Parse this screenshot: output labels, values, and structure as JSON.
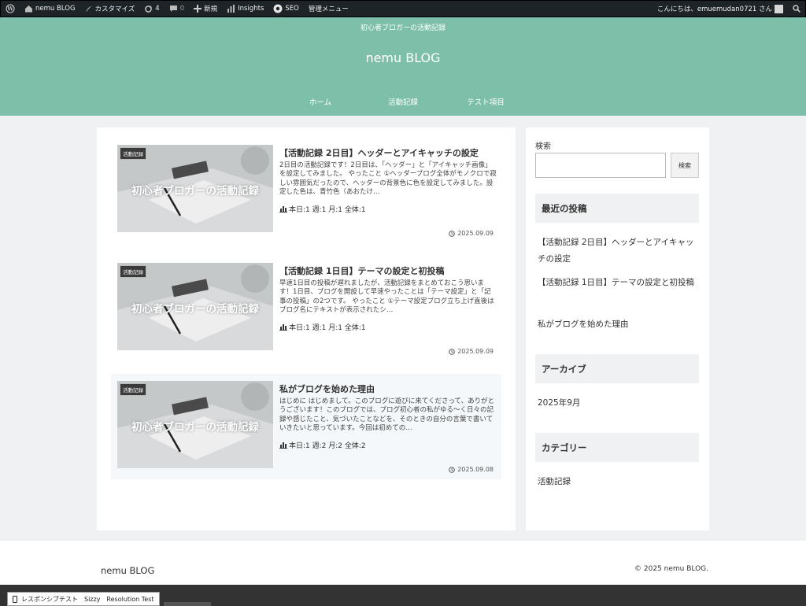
{
  "admin_bar": {
    "site_name": "nemu BLOG",
    "customize": "カスタマイズ",
    "updates_count": "4",
    "comments_count": "0",
    "new": "新規",
    "insights": "Insights",
    "seo": "SEO",
    "admin_menu": "管理メニュー",
    "greeting": "こんにちは、emuemudan0721 さん"
  },
  "header": {
    "tagline": "初心者ブロガーの活動記録",
    "site_title": "nemu BLOG",
    "nav": [
      "ホーム",
      "活動記録",
      "テスト項目"
    ]
  },
  "posts": [
    {
      "category": "活動記録",
      "thumb_text": "初心者ブロガーの活動記録",
      "title": "【活動記録 2日目】ヘッダーとアイキャッチの設定",
      "snippet": "2日目の活動記録です！2日目は、「ヘッダー」と「アイキャッチ画像」を設定してみました。 やったこと ①ヘッダーブログ全体がモノクロで寂しい雰囲気だったので、ヘッダーの背景色に色を設定してみました。設定した色は、青竹色（あおたけ…",
      "views": "本日:1 週:1 月:1 全体:1",
      "date": "2025.09.09"
    },
    {
      "category": "活動記録",
      "thumb_text": "初心者ブロガーの活動記録",
      "title": "【活動記録 1日目】テーマの設定と初投稿",
      "snippet": "早速1日目の投稿が遅れましたが、活動記録をまとめておこう思います！1日目、ブログを開設して早速やったことは「テーマ設定」と「記事の投稿」の2つです。 やったこと ①テーマ設定ブログ立ち上げ直後はブログ名にテキストが表示されたシ…",
      "views": "本日:1 週:1 月:1 全体:1",
      "date": "2025.09.09"
    },
    {
      "category": "活動記録",
      "thumb_text": "初心者ブロガーの活動記録",
      "title": "私がブログを始めた理由",
      "snippet": "はじめに はじめまして。このブログに遊びに来てくださって、ありがとうございます！このブログでは、ブログ初心者の私がゆる〜く日々の記録や感じたこと、気づいたことなどを、そのときの自分の言葉で書いていきたいと思っています。今回は初めての…",
      "views": "本日:1 週:2 月:2 全体:2",
      "date": "2025.09.08"
    }
  ],
  "sidebar": {
    "search_label": "検索",
    "search_value": "",
    "search_button": "検索",
    "recent_heading": "最近の投稿",
    "recent": [
      "【活動記録 2日目】ヘッダーとアイキャッチの設定",
      "【活動記録 1日目】テーマの設定と初投稿",
      "私がブログを始めた理由"
    ],
    "archive_heading": "アーカイブ",
    "archive": [
      "2025年9月"
    ],
    "category_heading": "カテゴリー",
    "categories": [
      "活動記録"
    ]
  },
  "footer": {
    "site_title": "nemu BLOG",
    "copyright": "© 2025 nemu BLOG."
  },
  "bottom_bar": {
    "label": "レスポンシブテスト　Sizzy　Resolution Test"
  },
  "colors": {
    "header_bg": "#7dbfa9",
    "admin_bar_bg": "#1d2327",
    "page_bg": "#f0f1f3"
  }
}
